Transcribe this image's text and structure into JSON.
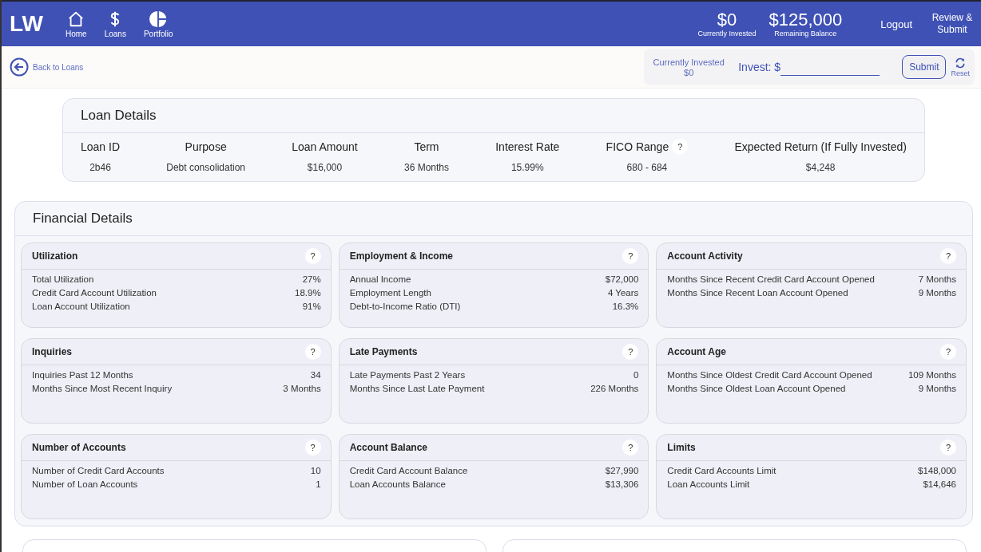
{
  "header": {
    "logo": "LW",
    "nav": [
      {
        "label": "Home",
        "kind": "home"
      },
      {
        "label": "Loans",
        "kind": "money"
      },
      {
        "label": "Portfolio",
        "kind": "portfolio"
      }
    ],
    "stats": [
      {
        "value": "$0",
        "label": "Currently Invested"
      },
      {
        "value": "$125,000",
        "label": "Remaining Balance"
      }
    ],
    "logout": "Logout",
    "review": "Review & Submit"
  },
  "toolbar": {
    "back": "Back to Loans",
    "invested_label": "Currently Invested",
    "invested_value": "$0",
    "invest_label": "Invest: $",
    "submit": "Submit",
    "reset": "Reset"
  },
  "loan_details": {
    "title": "Loan Details",
    "columns": [
      {
        "label": "Loan ID",
        "value": "2b46"
      },
      {
        "label": "Purpose",
        "value": "Debt consolidation"
      },
      {
        "label": "Loan Amount",
        "value": "$16,000"
      },
      {
        "label": "Term",
        "value": "36 Months"
      },
      {
        "label": "Interest Rate",
        "value": "15.99%"
      },
      {
        "label": "FICO Range",
        "value": "680 - 684",
        "help": "?"
      },
      {
        "label": "Expected Return (If Fully Invested)",
        "value": "$4,248"
      }
    ]
  },
  "financial_details": {
    "title": "Financial Details",
    "cards": [
      {
        "title": "Utilization",
        "help": "?",
        "rows": [
          {
            "label": "Total Utilization",
            "value": "27%"
          },
          {
            "label": "Credit Card Account Utilization",
            "value": "18.9%"
          },
          {
            "label": "Loan Account Utilization",
            "value": "91%"
          }
        ]
      },
      {
        "title": "Employment & Income",
        "help": "?",
        "rows": [
          {
            "label": "Annual Income",
            "value": "$72,000"
          },
          {
            "label": "Employment Length",
            "value": "4 Years"
          },
          {
            "label": "Debt-to-Income Ratio (DTI)",
            "value": "16.3%"
          }
        ]
      },
      {
        "title": "Account Activity",
        "help": "?",
        "rows": [
          {
            "label": "Months Since Recent Credit Card Account Opened",
            "value": "7 Months"
          },
          {
            "label": "Months Since Recent Loan Account Opened",
            "value": "9 Months"
          }
        ]
      },
      {
        "title": "Inquiries",
        "help": "?",
        "rows": [
          {
            "label": "Inquiries Past 12 Months",
            "value": "34"
          },
          {
            "label": "Months Since Most Recent Inquiry",
            "value": "3 Months"
          }
        ]
      },
      {
        "title": "Late Payments",
        "help": "?",
        "rows": [
          {
            "label": "Late Payments Past 2 Years",
            "value": "0"
          },
          {
            "label": "Months Since Last Late Payment",
            "value": "226 Months"
          }
        ]
      },
      {
        "title": "Account Age",
        "help": "?",
        "rows": [
          {
            "label": "Months Since Oldest Credit Card Account Opened",
            "value": "109 Months"
          },
          {
            "label": "Months Since Oldest Loan Account Opened",
            "value": "9 Months"
          }
        ]
      },
      {
        "title": "Number of Accounts",
        "help": "?",
        "rows": [
          {
            "label": "Number of Credit Card Accounts",
            "value": "10"
          },
          {
            "label": "Number of Loan Accounts",
            "value": "1"
          }
        ]
      },
      {
        "title": "Account Balance",
        "help": "?",
        "rows": [
          {
            "label": "Credit Card Account Balance",
            "value": "$27,990"
          },
          {
            "label": "Loan Accounts Balance",
            "value": "$13,306"
          }
        ]
      },
      {
        "title": "Limits",
        "help": "?",
        "rows": [
          {
            "label": "Credit Card Accounts Limit",
            "value": "$148,000"
          },
          {
            "label": "Loan Accounts Limit",
            "value": "$14,646"
          }
        ]
      }
    ]
  }
}
